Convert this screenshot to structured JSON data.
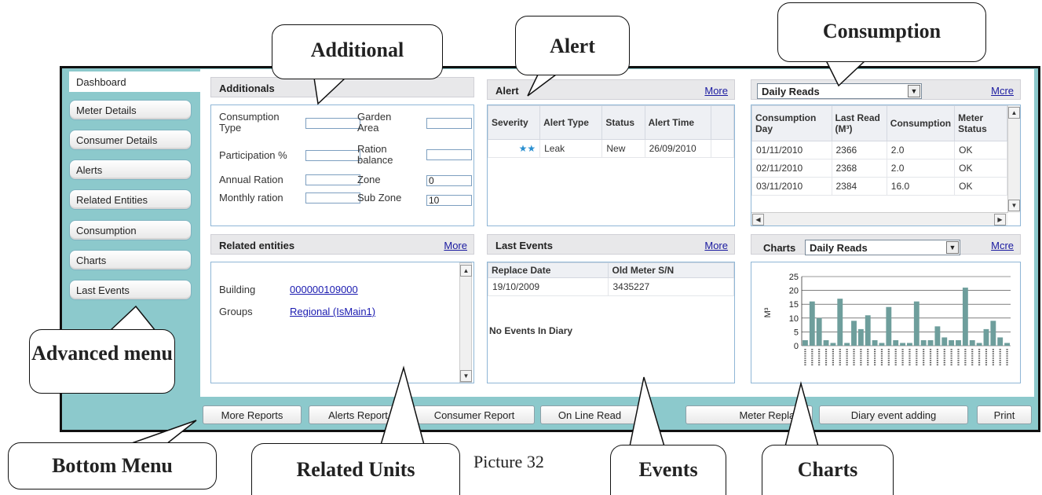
{
  "sidebar": {
    "items": [
      {
        "label": "Dashboard",
        "active": true
      },
      {
        "label": "Meter Details"
      },
      {
        "label": "Consumer Details"
      },
      {
        "label": "Alerts"
      },
      {
        "label": "Related Entities"
      },
      {
        "label": "Consumption"
      },
      {
        "label": "Charts"
      },
      {
        "label": "Last Events"
      }
    ]
  },
  "additionals": {
    "title": "Additionals",
    "fields": {
      "consumption_type": {
        "label": "Consumption Type",
        "value": ""
      },
      "participation": {
        "label": "Participation %",
        "value": ""
      },
      "annual_ration": {
        "label": "Annual Ration",
        "value": ""
      },
      "monthly_ration": {
        "label": "Monthly ration",
        "value": ""
      },
      "garden_area": {
        "label": "Garden Area",
        "value": ""
      },
      "ration_balance": {
        "label": "Ration balance",
        "value": ""
      },
      "zone": {
        "label": "Zone",
        "value": "0"
      },
      "sub_zone": {
        "label": "Sub Zone",
        "value": "10"
      }
    }
  },
  "alert": {
    "title": "Alert",
    "more": "More",
    "columns": [
      "Severity",
      "Alert Type",
      "Status",
      "Alert Time"
    ],
    "rows": [
      {
        "severity": "★★",
        "type": "Leak",
        "status": "New",
        "time": "26/09/2010"
      }
    ]
  },
  "consumption": {
    "select": "Daily Reads",
    "more": "Mcre",
    "columns": [
      "Consumption Day",
      "Last Read (M³)",
      "Consumption",
      "Meter Status"
    ],
    "rows": [
      {
        "day": "01/11/2010",
        "read": "2366",
        "cons": "2.0",
        "status": "OK"
      },
      {
        "day": "02/11/2010",
        "read": "2368",
        "cons": "2.0",
        "status": "OK"
      },
      {
        "day": "03/11/2010",
        "read": "2384",
        "cons": "16.0",
        "status": "OK"
      }
    ]
  },
  "related": {
    "title": "Related entities",
    "more": "More",
    "building_label": "Building",
    "building_value": "000000109000",
    "groups_label": "Groups",
    "groups_value": "Regional (IsMain1)"
  },
  "events": {
    "title": "Last Events",
    "more": "More",
    "columns": [
      "Replace Date",
      "Old Meter S/N"
    ],
    "rows": [
      {
        "date": "19/10/2009",
        "sn": "3435227"
      }
    ],
    "diary": "No Events In Diary"
  },
  "charts": {
    "label": "Charts",
    "select": "Daily Reads",
    "more": "Mcre"
  },
  "chart_data": {
    "type": "bar",
    "title": "",
    "xlabel": "",
    "ylabel": "M³",
    "ylim": [
      0,
      25
    ],
    "yticks": [
      "0",
      "5",
      "10",
      "15",
      "20",
      "25"
    ],
    "values": [
      2,
      16,
      10,
      2,
      1,
      17,
      1,
      9,
      6,
      11,
      2,
      1,
      14,
      2,
      1,
      1,
      16,
      2,
      2,
      7,
      3,
      2,
      2,
      21,
      2,
      1,
      6,
      9,
      3,
      1
    ]
  },
  "bottom": {
    "more_reports": "More Reports",
    "alerts_report": "Alerts Report",
    "consumer_report": "Consumer Report",
    "online_read": "On Line Read",
    "meter_replace": "Meter Replace",
    "diary": "Diary event adding",
    "print": "Print"
  },
  "callouts": {
    "additional": "Additional",
    "alert": "Alert",
    "consumption": "Consumption",
    "advanced": "Advanced menu",
    "bottom_menu": "Bottom Menu",
    "related_units": "Related Units",
    "events": "Events",
    "charts": "Charts"
  },
  "caption": "Picture 32"
}
